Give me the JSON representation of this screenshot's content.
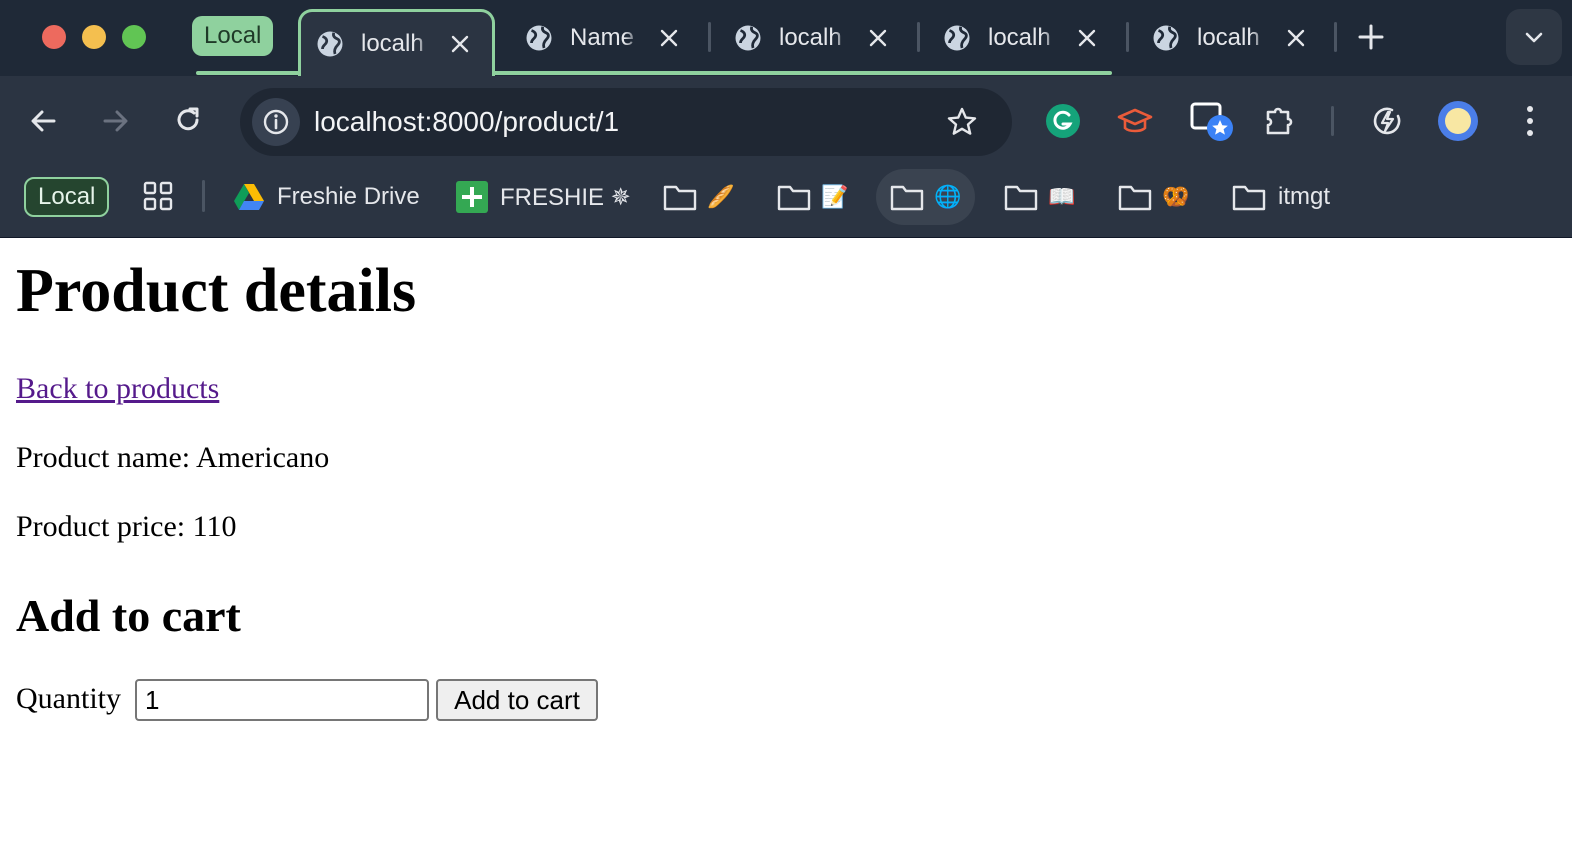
{
  "browser": {
    "tab_group_label": "Local",
    "tabs": [
      {
        "label": "localh",
        "active": true
      },
      {
        "label": "Name",
        "active": false
      },
      {
        "label": "localh",
        "active": false
      },
      {
        "label": "localh",
        "active": false
      },
      {
        "label": "localh",
        "active": false
      }
    ],
    "url": "localhost:8000/product/1",
    "bookmarks": {
      "group_label": "Local",
      "items": [
        {
          "label": "Freshie Drive",
          "icon": "google-drive-icon"
        },
        {
          "label": "FRESHIE ✵",
          "icon": "green-plus-icon"
        },
        {
          "emoji": "🥖",
          "icon": "folder-icon"
        },
        {
          "emoji": "📝",
          "icon": "folder-icon"
        },
        {
          "emoji": "🌐",
          "icon": "folder-icon"
        },
        {
          "emoji": "📖",
          "icon": "folder-icon"
        },
        {
          "emoji": "🥨",
          "icon": "folder-icon"
        },
        {
          "label": "itmgt",
          "icon": "folder-icon"
        }
      ]
    },
    "accent_color": "#8fd19e"
  },
  "page": {
    "title": "Product details",
    "back_link": "Back to products",
    "product_name_line": "Product name: Americano",
    "product_price_line": "Product price: 110",
    "form_heading": "Add to cart",
    "quantity_label": "Quantity",
    "quantity_value": "1",
    "submit_label": "Add to cart"
  }
}
